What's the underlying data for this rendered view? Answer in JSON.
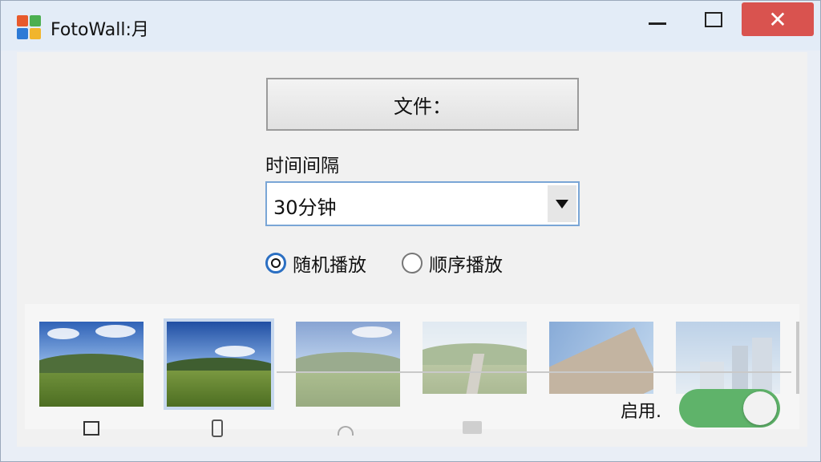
{
  "window": {
    "title": "FotoWall:月",
    "close_glyph": "✕"
  },
  "main": {
    "file_button_label": "文件：",
    "interval_label": "时间间隔",
    "interval_value": "30分钟",
    "radio_options": [
      {
        "label": "随机播放",
        "selected": true
      },
      {
        "label": "顺序播放",
        "selected": false
      }
    ]
  },
  "gallery": {
    "enable_label": "启用.",
    "enabled": true,
    "thumbnails": [
      {
        "name": "mountain-meadow-1",
        "selected": false
      },
      {
        "name": "mountain-meadow-2",
        "selected": true
      },
      {
        "name": "mountain-meadow-3",
        "selected": false
      },
      {
        "name": "road-valley",
        "selected": false
      },
      {
        "name": "rocky-slope",
        "selected": false
      },
      {
        "name": "city-buildings",
        "selected": false
      }
    ],
    "device_icons": [
      "tablet-icon",
      "phone-icon",
      "headset-icon",
      "folder-icon"
    ]
  },
  "colors": {
    "toggle_on": "#5fb36a",
    "close_button": "#d9534f",
    "selection_ring": "#2b6fc2"
  }
}
